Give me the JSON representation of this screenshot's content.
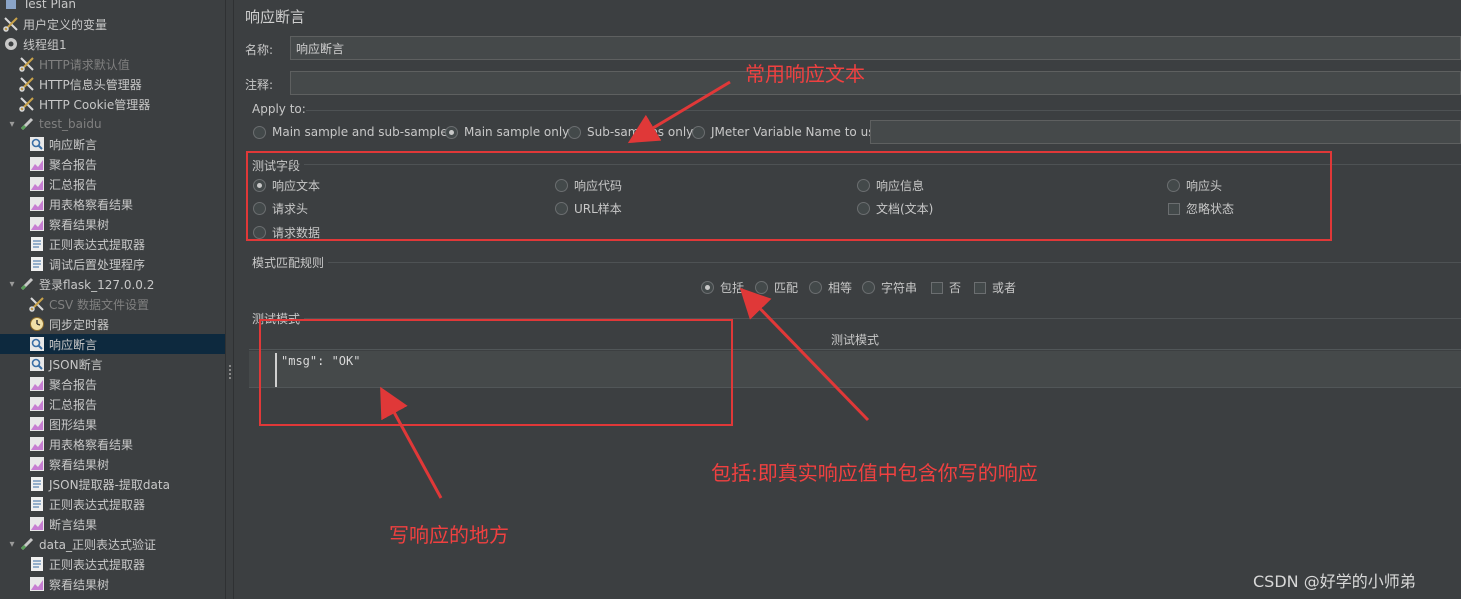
{
  "tree": {
    "items": [
      {
        "label": "Test Plan",
        "icon": "test-plan-icon",
        "indent": 0,
        "toggle": "",
        "disabled": false,
        "selected": false
      },
      {
        "label": "用户定义的变量",
        "icon": "scissors-icon",
        "indent": 0,
        "toggle": "",
        "disabled": false,
        "selected": false
      },
      {
        "label": "线程组1",
        "icon": "gear-icon",
        "indent": 0,
        "toggle": "",
        "disabled": false,
        "selected": false
      },
      {
        "label": "HTTP请求默认值",
        "icon": "scissors-icon",
        "indent": 1,
        "toggle": "",
        "disabled": true,
        "selected": false
      },
      {
        "label": "HTTP信息头管理器",
        "icon": "scissors-icon",
        "indent": 1,
        "toggle": "",
        "disabled": false,
        "selected": false
      },
      {
        "label": "HTTP Cookie管理器",
        "icon": "scissors-icon",
        "indent": 1,
        "toggle": "",
        "disabled": false,
        "selected": false
      },
      {
        "label": "test_baidu",
        "icon": "sampler-pen-icon",
        "indent": 1,
        "toggle": "▾",
        "disabled": true,
        "selected": false
      },
      {
        "label": "响应断言",
        "icon": "magnifier-icon",
        "indent": 2,
        "toggle": "",
        "disabled": false,
        "selected": false
      },
      {
        "label": "聚合报告",
        "icon": "chart-icon",
        "indent": 2,
        "toggle": "",
        "disabled": false,
        "selected": false
      },
      {
        "label": "汇总报告",
        "icon": "chart-icon",
        "indent": 2,
        "toggle": "",
        "disabled": false,
        "selected": false
      },
      {
        "label": "用表格察看结果",
        "icon": "chart-icon",
        "indent": 2,
        "toggle": "",
        "disabled": false,
        "selected": false
      },
      {
        "label": "察看结果树",
        "icon": "chart-icon",
        "indent": 2,
        "toggle": "",
        "disabled": false,
        "selected": false
      },
      {
        "label": "正则表达式提取器",
        "icon": "document-icon",
        "indent": 2,
        "toggle": "",
        "disabled": false,
        "selected": false
      },
      {
        "label": "调试后置处理程序",
        "icon": "document-icon",
        "indent": 2,
        "toggle": "",
        "disabled": false,
        "selected": false
      },
      {
        "label": "登录flask_127.0.0.2",
        "icon": "sampler-pen-icon",
        "indent": 1,
        "toggle": "▾",
        "disabled": false,
        "selected": false
      },
      {
        "label": "CSV 数据文件设置",
        "icon": "scissors-icon",
        "indent": 2,
        "toggle": "",
        "disabled": true,
        "selected": false
      },
      {
        "label": "同步定时器",
        "icon": "timer-icon",
        "indent": 2,
        "toggle": "",
        "disabled": false,
        "selected": false
      },
      {
        "label": "响应断言",
        "icon": "magnifier-icon",
        "indent": 2,
        "toggle": "",
        "disabled": false,
        "selected": true
      },
      {
        "label": "JSON断言",
        "icon": "magnifier-icon",
        "indent": 2,
        "toggle": "",
        "disabled": false,
        "selected": false
      },
      {
        "label": "聚合报告",
        "icon": "chart-icon",
        "indent": 2,
        "toggle": "",
        "disabled": false,
        "selected": false
      },
      {
        "label": "汇总报告",
        "icon": "chart-icon",
        "indent": 2,
        "toggle": "",
        "disabled": false,
        "selected": false
      },
      {
        "label": "图形结果",
        "icon": "chart-icon",
        "indent": 2,
        "toggle": "",
        "disabled": false,
        "selected": false
      },
      {
        "label": "用表格察看结果",
        "icon": "chart-icon",
        "indent": 2,
        "toggle": "",
        "disabled": false,
        "selected": false
      },
      {
        "label": "察看结果树",
        "icon": "chart-icon",
        "indent": 2,
        "toggle": "",
        "disabled": false,
        "selected": false
      },
      {
        "label": "JSON提取器-提取data",
        "icon": "document-icon",
        "indent": 2,
        "toggle": "",
        "disabled": false,
        "selected": false
      },
      {
        "label": "正则表达式提取器",
        "icon": "document-icon",
        "indent": 2,
        "toggle": "",
        "disabled": false,
        "selected": false
      },
      {
        "label": "断言结果",
        "icon": "chart-icon",
        "indent": 2,
        "toggle": "",
        "disabled": false,
        "selected": false
      },
      {
        "label": "data_正则表达式验证",
        "icon": "sampler-pen-icon",
        "indent": 1,
        "toggle": "▾",
        "disabled": false,
        "selected": false
      },
      {
        "label": "正则表达式提取器",
        "icon": "document-icon",
        "indent": 2,
        "toggle": "",
        "disabled": false,
        "selected": false
      },
      {
        "label": "察看结果树",
        "icon": "chart-icon",
        "indent": 2,
        "toggle": "",
        "disabled": false,
        "selected": false
      }
    ]
  },
  "panel": {
    "title": "响应断言",
    "name_label": "名称:",
    "name_value": "响应断言",
    "comment_label": "注释:",
    "comment_value": "",
    "apply_to": {
      "title": "Apply to:",
      "options": [
        "Main sample and sub-samples",
        "Main sample only",
        "Sub-samples only",
        "JMeter Variable Name to use"
      ],
      "selected": "Main sample only",
      "variable_value": ""
    },
    "test_field": {
      "title": "测试字段",
      "options": [
        "响应文本",
        "响应代码",
        "响应信息",
        "响应头",
        "请求头",
        "URL样本",
        "文档(文本)",
        "请求数据"
      ],
      "selected": "响应文本",
      "ignore_status_label": "忽略状态",
      "ignore_status_checked": false
    },
    "match_rules": {
      "title": "模式匹配规则",
      "options": [
        "包括",
        "匹配",
        "相等",
        "字符串"
      ],
      "selected": "包括",
      "not_label": "否",
      "or_label": "或者"
    },
    "patterns": {
      "title": "测试模式",
      "column_header": "测试模式",
      "rows": [
        "\"msg\": \"OK\""
      ]
    }
  },
  "annotations": {
    "common_response_text": "常用响应文本",
    "include_explanation": "包括:即真实响应值中包含你写的响应",
    "write_response_here": "写响应的地方",
    "color": "#e03838"
  },
  "watermark": "CSDN @好学的小师弟",
  "colors": {
    "background": "#3c3f41",
    "selected_row": "#0d293e",
    "field_bg": "#45494a",
    "annotation_red": "#e03838"
  }
}
